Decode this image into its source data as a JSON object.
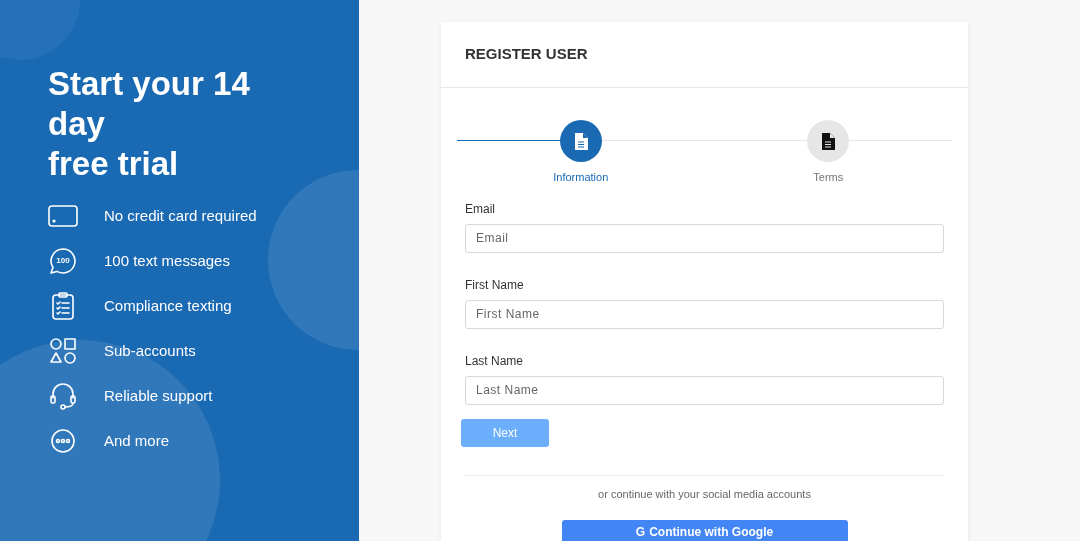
{
  "promo": {
    "title_lines": [
      "Start your 14 day",
      "free trial"
    ],
    "features": [
      {
        "kind": "card",
        "label": "No credit card required"
      },
      {
        "kind": "chat",
        "label": "100 text messages",
        "icon_text": "100"
      },
      {
        "kind": "clipboard",
        "label": "Compliance texting"
      },
      {
        "kind": "shapes",
        "label": "Sub-accounts"
      },
      {
        "kind": "headset",
        "label": "Reliable support"
      },
      {
        "kind": "more",
        "label": "And more"
      }
    ]
  },
  "form": {
    "title": "REGISTER USER",
    "steps": [
      {
        "label": "Information",
        "selected": true
      },
      {
        "label": "Terms",
        "selected": false
      }
    ],
    "fields": [
      {
        "label": "Email",
        "placeholder": "Email"
      },
      {
        "label": "First Name",
        "placeholder": "First Name"
      },
      {
        "label": "Last Name",
        "placeholder": "Last Name"
      }
    ],
    "next_button": {
      "label": "Next",
      "disabled": true
    },
    "social_text": "or continue with your social media accounts",
    "google_button": {
      "icon_text": "G",
      "label": "Continue with Google"
    }
  }
}
